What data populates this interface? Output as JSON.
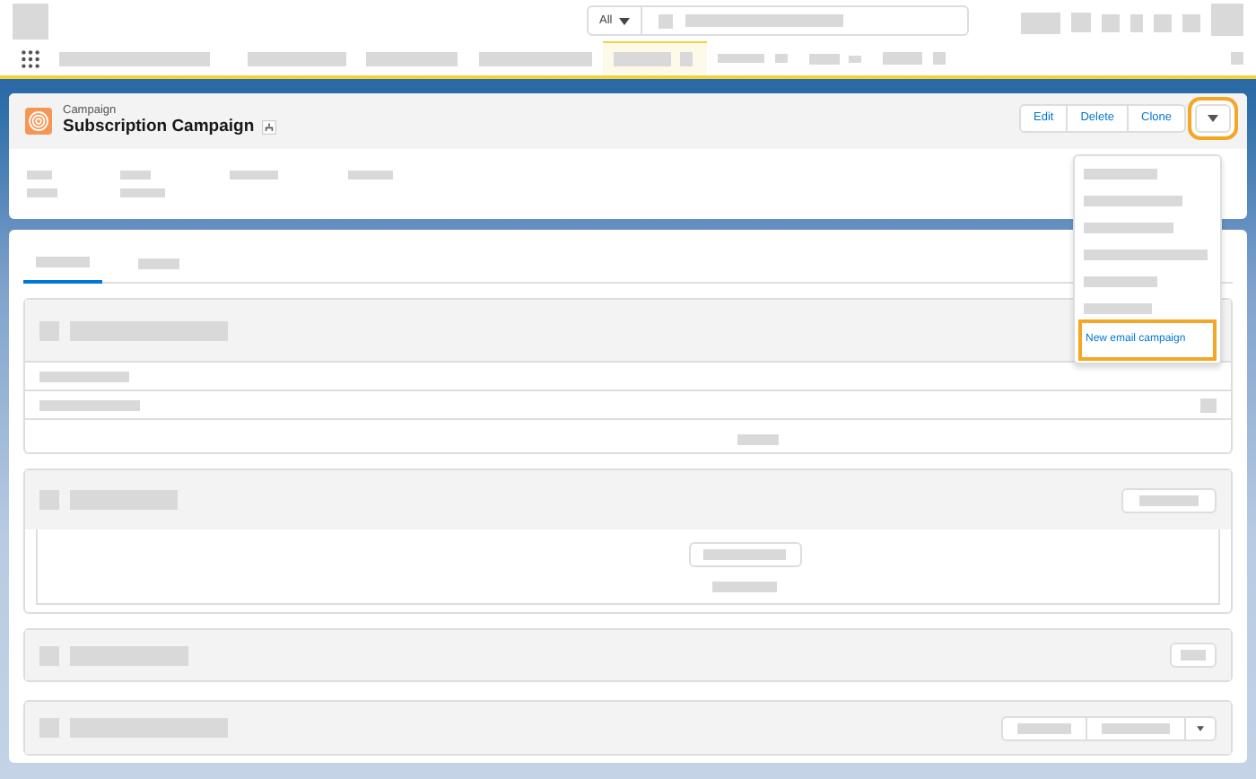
{
  "search": {
    "scope": "All"
  },
  "record": {
    "object_type": "Campaign",
    "title": "Subscription Campaign"
  },
  "actions": [
    "Edit",
    "Delete",
    "Clone"
  ],
  "menu_button": {
    "highlighted": true,
    "expanded": true
  },
  "menu": {
    "items": [
      {
        "label": "New email campaign",
        "highlighted": true
      }
    ]
  }
}
